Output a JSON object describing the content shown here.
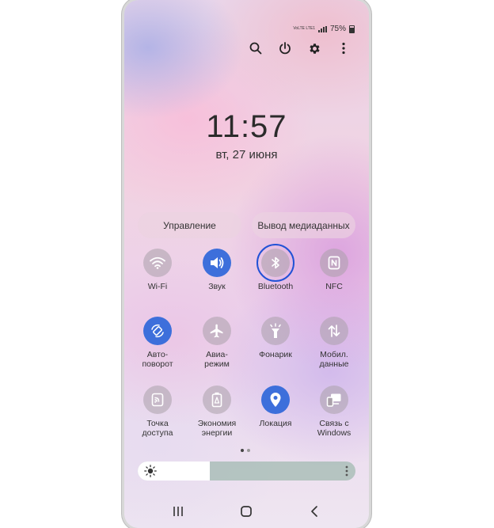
{
  "status_bar": {
    "signal_text": "VoLTE LTE1",
    "battery_percent": "75%"
  },
  "top_actions": [
    {
      "name": "search-icon"
    },
    {
      "name": "power-icon"
    },
    {
      "name": "gear-icon"
    },
    {
      "name": "more-vert-icon"
    }
  ],
  "clock": {
    "time": "11:57",
    "date": "вт, 27 июня"
  },
  "panel_buttons": {
    "control": "Управление",
    "media_output": "Вывод медиаданных"
  },
  "tiles": [
    {
      "icon": "wifi-icon",
      "line1": "Wi-Fi",
      "line2": "",
      "active": false
    },
    {
      "icon": "sound-icon",
      "line1": "Звук",
      "line2": "",
      "active": true
    },
    {
      "icon": "bluetooth-icon",
      "line1": "Bluetooth",
      "line2": "",
      "active": false,
      "highlighted": true
    },
    {
      "icon": "nfc-icon",
      "line1": "NFC",
      "line2": "",
      "active": false
    },
    {
      "icon": "auto-rotate-icon",
      "line1": "Авто-",
      "line2": "поворот",
      "active": true
    },
    {
      "icon": "airplane-icon",
      "line1": "Авиа-",
      "line2": "режим",
      "active": false
    },
    {
      "icon": "flashlight-icon",
      "line1": "Фонарик",
      "line2": "",
      "active": false
    },
    {
      "icon": "mobile-data-icon",
      "line1": "Мобил.",
      "line2": "данные",
      "active": false
    },
    {
      "icon": "hotspot-icon",
      "line1": "Точка",
      "line2": "доступа",
      "active": false
    },
    {
      "icon": "battery-saver-icon",
      "line1": "Экономия",
      "line2": "энергии",
      "active": false
    },
    {
      "icon": "location-icon",
      "line1": "Локация",
      "line2": "",
      "active": true
    },
    {
      "icon": "link-windows-icon",
      "line1": "Связь с",
      "line2": "Windows",
      "active": false
    }
  ],
  "page_dots": {
    "count": 2,
    "current": 1
  },
  "brightness": {
    "level": 0.33
  },
  "navbar": [
    {
      "name": "recent-apps-icon"
    },
    {
      "name": "home-icon"
    },
    {
      "name": "back-icon"
    }
  ],
  "colors": {
    "accent": "#3d6fdb",
    "focus_ring": "#2252d6",
    "tile_off": "#aaa0aa"
  }
}
